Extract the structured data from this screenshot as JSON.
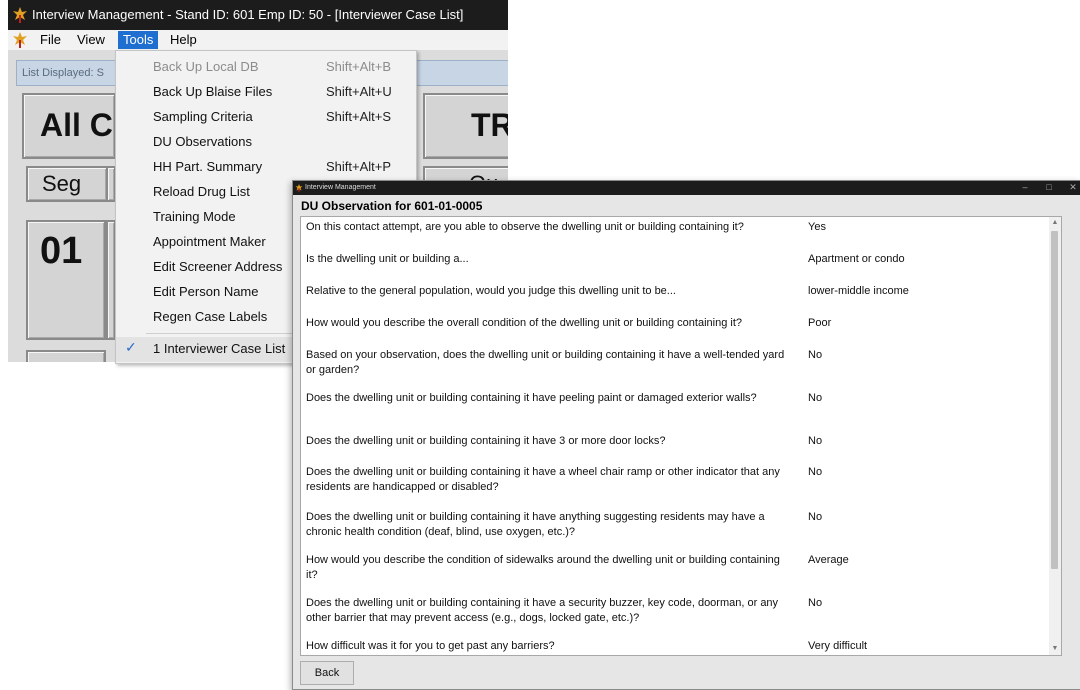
{
  "back_window": {
    "title": "Interview Management - Stand ID: 601  Emp ID: 50 - [Interviewer Case List]",
    "menubar": {
      "file": "File",
      "view": "View",
      "tools": "Tools",
      "help": "Help"
    },
    "list_displayed": "List Displayed: S",
    "buttons": {
      "all_c": "All C",
      "tr": "TR",
      "seg": "Seg",
      "qu": "Qu",
      "num_01": "01"
    }
  },
  "tools_menu": {
    "items": [
      {
        "label": "Back Up Local DB",
        "shortcut": "Shift+Alt+B",
        "disabled": true
      },
      {
        "label": "Back Up Blaise Files",
        "shortcut": "Shift+Alt+U"
      },
      {
        "label": "Sampling Criteria",
        "shortcut": "Shift+Alt+S"
      },
      {
        "label": "DU Observations",
        "shortcut": ""
      },
      {
        "label": "HH Part. Summary",
        "shortcut": "Shift+Alt+P"
      },
      {
        "label": "Reload Drug List",
        "shortcut": ""
      },
      {
        "label": "Training Mode",
        "shortcut": ""
      },
      {
        "label": "Appointment Maker",
        "shortcut": ""
      },
      {
        "label": "Edit Screener Address",
        "shortcut": ""
      },
      {
        "label": "Edit Person Name",
        "shortcut": ""
      },
      {
        "label": "Regen Case Labels",
        "shortcut": ""
      }
    ],
    "window_item": {
      "label": "1 Interviewer Case List",
      "checked": true
    }
  },
  "front_window": {
    "title": "Interview Management",
    "heading": "DU Observation for 601-01-0005",
    "rows": [
      {
        "question": "On this contact attempt, are you able to observe the dwelling unit or building containing it?",
        "answer": "Yes"
      },
      {
        "question": "Is the dwelling unit or building a...",
        "answer": "Apartment or condo"
      },
      {
        "question": "Relative to the general population, would you judge this dwelling unit to be...",
        "answer": "lower-middle income"
      },
      {
        "question": "How would you describe the overall condition of the dwelling unit or building containing it?",
        "answer": "Poor"
      },
      {
        "question": "Based on your observation, does the dwelling unit or building containing it have a well-tended yard or garden?",
        "answer": "No"
      },
      {
        "question": "Does the dwelling unit or building containing it have peeling paint or damaged exterior walls?",
        "answer": "No"
      },
      {
        "question": "Does the dwelling unit or building containing it have 3 or more door locks?",
        "answer": "No"
      },
      {
        "question": "Does the dwelling unit or building containing it have a wheel chair ramp or other indicator that any residents are handicapped or disabled?",
        "answer": "No"
      },
      {
        "question": "Does the dwelling unit or building containing it have anything suggesting residents may have a chronic health condition (deaf, blind, use oxygen, etc.)?",
        "answer": "No"
      },
      {
        "question": "How would you describe the condition of sidewalks around the dwelling unit or building containing it?",
        "answer": "Average"
      },
      {
        "question": "Does the dwelling unit or building containing it have a security buzzer, key code, doorman, or any other barrier that may prevent access (e.g., dogs, locked gate, etc.)?",
        "answer": "No"
      },
      {
        "question": "How difficult was it for you to get past any barriers?",
        "answer": "Very difficult"
      }
    ],
    "back_button": "Back"
  },
  "colors": {
    "menu_highlight": "#1f6fd0",
    "titlebar": "#1c1c1c",
    "check": "#2b6ccc"
  }
}
